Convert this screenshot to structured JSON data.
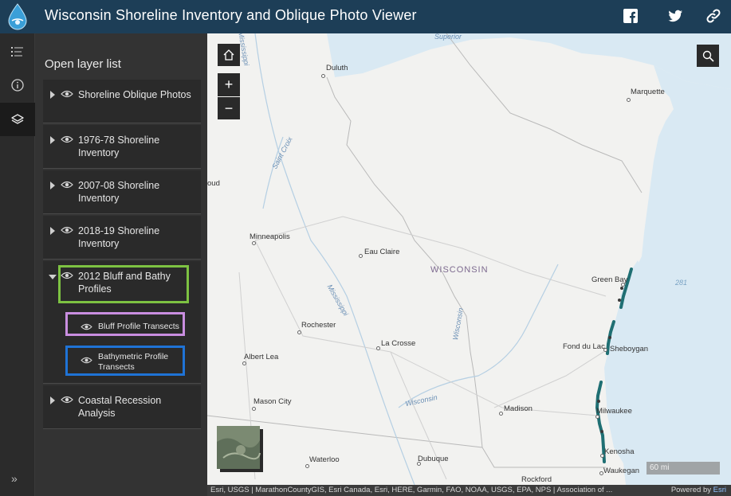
{
  "header": {
    "title": "Wisconsin Shoreline Inventory and Oblique Photo Viewer",
    "icons": [
      "facebook-icon",
      "twitter-icon",
      "link-icon"
    ]
  },
  "rail": {
    "buttons": [
      "layer-list-icon",
      "info-icon",
      "layers-icon"
    ],
    "collapse_label": "»"
  },
  "panel": {
    "title": "Open layer list",
    "layers": [
      {
        "label": "Shoreline Oblique Photos",
        "expanded": false
      },
      {
        "label": "1976-78 Shoreline Inventory",
        "expanded": false
      },
      {
        "label": "2007-08 Shoreline Inventory",
        "expanded": false
      },
      {
        "label": "2018-19 Shoreline Inventory",
        "expanded": false
      },
      {
        "label": "2012 Bluff and Bathy Profiles",
        "expanded": true,
        "sublayers": [
          {
            "label": "Bluff Profile Transects"
          },
          {
            "label": "Bathymetric Profile Transects"
          }
        ]
      },
      {
        "label": "Coastal Recession Analysis",
        "expanded": false
      }
    ],
    "highlight_colors": {
      "group": "#7dc242",
      "bluff": "#c98ee0",
      "bathy": "#1f73d6"
    }
  },
  "map": {
    "controls": {
      "zoom_in": "+",
      "zoom_out": "−"
    },
    "cities": {
      "duluth": "Duluth",
      "marquette": "Marquette",
      "minneapolis": "Minneapolis",
      "eau_claire": "Eau Claire",
      "green_bay": "Green Bay",
      "rochester": "Rochester",
      "la_crosse": "La Crosse",
      "fond_du_lac": "Fond du Lac",
      "sheboygan": "Sheboygan",
      "albert_lea": "Albert Lea",
      "mason_city": "Mason City",
      "madison": "Madison",
      "milwaukee": "Milwaukee",
      "kenosha": "Kenosha",
      "waterloo": "Waterloo",
      "dubuque": "Dubuque",
      "waukegan": "Waukegan",
      "rockford": "Rockford",
      "partial_left": "oud"
    },
    "state_label": "WISCONSIN",
    "water_labels": {
      "superior": "Superior",
      "mississippi_top": "Mississippi",
      "st_croix": "Saint Croix",
      "mississippi_mid": "Mississippi",
      "wisconsin_river": "Wisconsin",
      "wisconsin_river2": "Wisconsin",
      "route_281": "281"
    },
    "scale": "60 mi",
    "colors": {
      "land": "#f2f2f0",
      "water": "#d9e9f3",
      "transect": "#1f6f73"
    }
  },
  "attribution": {
    "text": "Esri, USGS | MarathonCountyGIS, Esri Canada, Esri, HERE, Garmin, FAO, NOAA, USGS, EPA, NPS | Association of ...",
    "powered_prefix": "Powered by ",
    "powered_brand": "Esri"
  }
}
